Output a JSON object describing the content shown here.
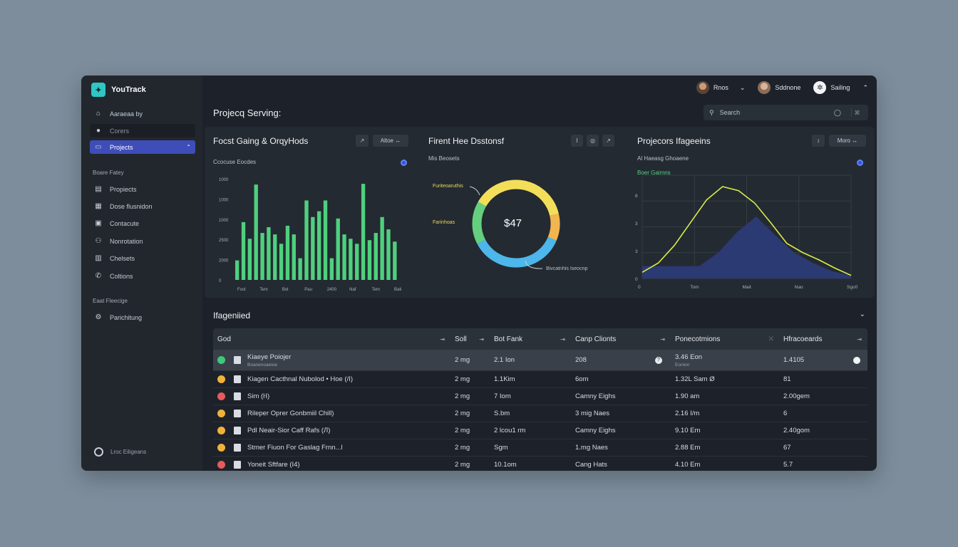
{
  "app": {
    "name": "YouTrack"
  },
  "sidebar": {
    "items": [
      {
        "label": "Aaraeaa by",
        "icon": "home-icon"
      },
      {
        "label": "Corers",
        "icon": "person-icon"
      },
      {
        "label": "Projects",
        "icon": "folder-icon"
      }
    ],
    "section1_label": "Boare Fatey",
    "section1_items": [
      {
        "label": "Propiects",
        "icon": "clipboard-icon"
      },
      {
        "label": "Dose flusnidon",
        "icon": "calendar-icon"
      },
      {
        "label": "Contacute",
        "icon": "contact-icon"
      },
      {
        "label": "Nonrotation",
        "icon": "group-icon"
      },
      {
        "label": "Chelsets",
        "icon": "chart-icon"
      },
      {
        "label": "Coltions",
        "icon": "phone-icon"
      }
    ],
    "section2_label": "Eaat Fleecige",
    "section2_items": [
      {
        "label": "Parichitung",
        "icon": "settings-icon"
      }
    ],
    "footer_label": "Lroc Eiligeans"
  },
  "topbar": {
    "users": [
      {
        "name": "Rnos"
      },
      {
        "name": "Sddnone"
      },
      {
        "name": "Sailing"
      }
    ]
  },
  "page": {
    "title": "Projecq Serving:"
  },
  "search": {
    "placeholder": "Search"
  },
  "panels": {
    "p1": {
      "title": "Focst Gaing & OrqyНods",
      "sub": "Ccocuse Eocdes",
      "ctl1": "↗",
      "ctl2": "Altoe ↔"
    },
    "p2": {
      "title": "Firent Hee Dsstonsf",
      "sub": "Mis Beosets",
      "ctl1": "I",
      "ctl2": "◎",
      "ctl3": "↗",
      "ring_value": "$47",
      "label_a": "Furiteoaruthis",
      "label_b": "Farinhoas",
      "label_c": "Bivcatnhis Iseocnp"
    },
    "p3": {
      "title": "Projecors Ifageeins",
      "sub": "Al Haeasg Ghoaene",
      "sub2": "Boer Gaimns",
      "ctl1": "↕",
      "ctl2": "Moro ↔"
    }
  },
  "chart_data": [
    {
      "type": "bar",
      "title": "Focst Gaing & OrqyНods",
      "ylabels": [
        "1000",
        "1000",
        "1000",
        "2500",
        "2000",
        "0"
      ],
      "xlabels": [
        "Fost",
        "Tem",
        "Bol",
        "Pau",
        "2400",
        "Naf",
        "Tem",
        "Bati"
      ],
      "values": [
        27,
        80,
        57,
        132,
        65,
        73,
        63,
        50,
        75,
        63,
        30,
        110,
        87,
        95,
        110,
        30,
        85,
        63,
        57,
        50,
        133,
        55,
        65,
        87,
        70,
        53
      ],
      "ylim": [
        0,
        140
      ],
      "color": "#4fd07e"
    },
    {
      "type": "pie",
      "title": "Firent Hee Dsstonsf",
      "slices": [
        {
          "label": "yellow",
          "value": 38,
          "color": "#f3de5a"
        },
        {
          "label": "orange",
          "value": 10,
          "color": "#f2b54f"
        },
        {
          "label": "blue",
          "value": 36,
          "color": "#4db6ea"
        },
        {
          "label": "green",
          "value": 16,
          "color": "#64d07f"
        }
      ]
    },
    {
      "type": "area",
      "title": "Projecors Ifageeins",
      "ylabels": [
        "8",
        "3",
        "3",
        "0"
      ],
      "xlabels": [
        "0",
        "Tom",
        "Mait",
        "Nao",
        "Sgo0"
      ],
      "line": [
        0.6,
        1.5,
        3.2,
        5.4,
        7.6,
        8.9,
        8.5,
        7.3,
        5.4,
        3.4,
        2.5,
        1.8,
        1.0,
        0.3
      ],
      "area": [
        1.2,
        1.2,
        1.2,
        1.2,
        2.5,
        4.5,
        6.0,
        4.2,
        2.5,
        1.5,
        0.7,
        0.3
      ],
      "line_color": "#d8ec4b",
      "area_color": "#2b3a72"
    }
  ],
  "section2": {
    "title": "Ifageniied"
  },
  "table": {
    "headers": [
      "God",
      "Soll",
      "Bot Fank",
      "Canp Clionts",
      "Ponecotmions",
      "Hfracoeards"
    ],
    "rows": [
      {
        "name": "Kiaeye Poiojer",
        "sub": "Boanenoaeioe",
        "soll": "2 mg",
        "bot": "2.1 Ion",
        "camp": "208",
        "pone": "3.46 Eon",
        "pone_sub": "Eonion",
        "hfr": "1.4105",
        "status": "#3cc97a",
        "selected": true
      },
      {
        "name": "Kiagen Cacthnal Nubolod • Hoe (/I)",
        "soll": "2 mg",
        "bot": "1.1Kim",
        "camp": "6om",
        "pone": "1.32L Sam Ø",
        "hfr": "81",
        "status": "#f1b23a"
      },
      {
        "name": "Sim (ŀI)",
        "soll": "2 mg",
        "bot": "7 Іom",
        "camp": "Camny Eighs",
        "pone": "1.90 am",
        "hfr": "2.00gem",
        "status": "#e65b5b"
      },
      {
        "name": "Rileper Oprer Gonbmiil Chill)",
        "soll": "2 mg",
        "bot": "S.bm",
        "camp": "3 mig Naes",
        "pone": "2.16 I/m",
        "hfr": "6",
        "status": "#f1b23a"
      },
      {
        "name": "Pdl Neair-Sior Caff Rafs (Л)",
        "soll": "2 mg",
        "bot": "2 lcou1 rm",
        "camp": "Camny Eighs",
        "pone": "9.10 Em",
        "hfr": "2.40gom",
        "status": "#f1b23a"
      },
      {
        "name": "Stmer Fiuon For Gaslag Frnn...l",
        "soll": "2 mg",
        "bot": "Sgm",
        "camp": "1.mg Naes",
        "pone": "2.88 Em",
        "hfr": "67",
        "status": "#f1b23a"
      },
      {
        "name": "Yoneit Sftfare (I4)",
        "soll": "2 mg",
        "bot": "10.1om",
        "camp": "Cang Hats",
        "pone": "4.10 Em",
        "hfr": "5.7",
        "status": "#e65b5b"
      }
    ]
  }
}
